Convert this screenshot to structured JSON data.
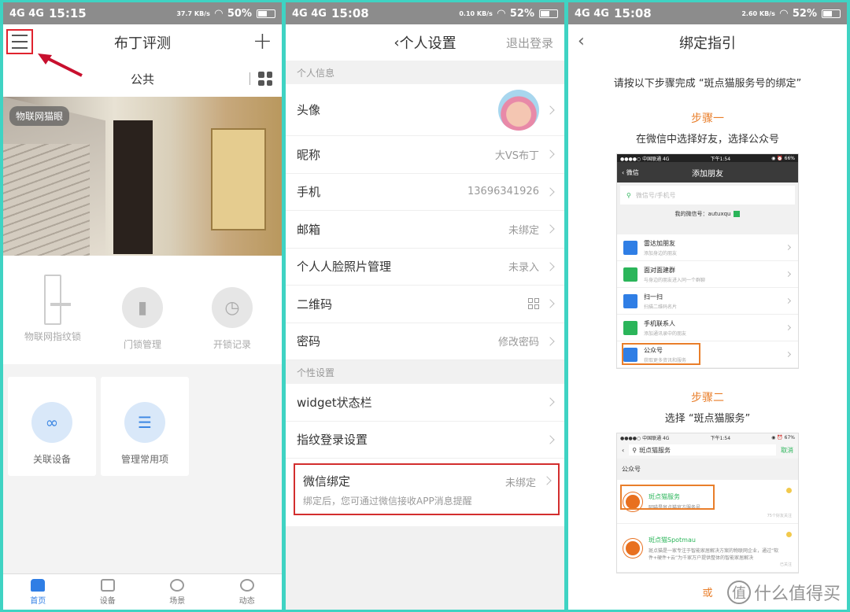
{
  "panel1": {
    "status": {
      "signal": "4G 4G",
      "time": "15:15",
      "speed": "37.7 KB/s",
      "battery": "50%"
    },
    "title": "布丁评测",
    "tab": "公共",
    "camera_tag": "物联网猫眼",
    "devices": [
      {
        "label": "物联网指纹锁",
        "icon": "door-lock-icon"
      },
      {
        "label": "门锁管理",
        "icon": "lock-manage-icon"
      },
      {
        "label": "开锁记录",
        "icon": "clock-icon"
      }
    ],
    "cards": [
      {
        "label": "关联设备",
        "icon": "link-icon"
      },
      {
        "label": "管理常用项",
        "icon": "settings-list-icon"
      }
    ],
    "bottom_nav": [
      {
        "label": "首页",
        "active": true
      },
      {
        "label": "设备"
      },
      {
        "label": "场景"
      },
      {
        "label": "动态"
      }
    ]
  },
  "panel2": {
    "status": {
      "signal": "4G 4G",
      "time": "15:08",
      "speed": "0.10 KB/s",
      "battery": "52%"
    },
    "title": "个人设置",
    "logout": "退出登录",
    "section_personal": "个人信息",
    "rows": [
      {
        "label": "头像",
        "value": ""
      },
      {
        "label": "昵称",
        "value": "大VS布丁"
      },
      {
        "label": "手机",
        "value": "13696341926"
      },
      {
        "label": "邮箱",
        "value": "未绑定"
      },
      {
        "label": "个人人脸照片管理",
        "value": "未录入"
      },
      {
        "label": "二维码",
        "value": ""
      },
      {
        "label": "密码",
        "value": "修改密码"
      }
    ],
    "section_custom": "个性设置",
    "custom_rows": [
      {
        "label": "widget状态栏"
      },
      {
        "label": "指纹登录设置"
      }
    ],
    "wechat": {
      "label": "微信绑定",
      "value": "未绑定",
      "sub": "绑定后，您可通过微信接收APP消息提醒"
    }
  },
  "panel3": {
    "status": {
      "signal": "4G 4G",
      "time": "15:08",
      "speed": "2.60 KB/s",
      "battery": "52%"
    },
    "title": "绑定指引",
    "intro": "请按以下步骤完成 “斑点猫服务号的绑定”",
    "step1_title": "步骤一",
    "step1_desc": "在微信中选择好友，选择公众号",
    "shot1": {
      "status_left": "●●●●○ 中国联通  4G",
      "status_time": "下午1:54",
      "status_right": "◉ ⏰ 66%",
      "back": "微信",
      "title": "添加朋友",
      "search_placeholder": "微信号/手机号",
      "my_id": "我的微信号：autuxqu",
      "items": [
        {
          "title": "雷达加朋友",
          "sub": "添加身边的朋友",
          "color": "#2f7ee5"
        },
        {
          "title": "面对面建群",
          "sub": "与身边的朋友进入同一个群聊",
          "color": "#2bb55a"
        },
        {
          "title": "扫一扫",
          "sub": "扫描二维码名片",
          "color": "#2f7ee5"
        },
        {
          "title": "手机联系人",
          "sub": "添加通讯录中的朋友",
          "color": "#2bb55a"
        },
        {
          "title": "公众号",
          "sub": "获取更多资讯和服务",
          "color": "#2f7ee5"
        }
      ]
    },
    "step2_title": "步骤二",
    "step2_desc": "选择 “斑点猫服务”",
    "shot2": {
      "status_left": "●●●●○ 中国联通  4G",
      "status_time": "下午1:54",
      "status_right": "◉ ⏰ 67%",
      "search_value": "斑点猫服务",
      "cancel": "取消",
      "section": "公众号",
      "accounts": [
        {
          "title": "斑点猫服务",
          "sub": "阿喵是斑点猫官方服务号",
          "meta": "75个好友关注"
        },
        {
          "title": "斑点猫Spotmau",
          "sub": "斑点猫是一家专注于智能家居解决方案的物联网企业，通过“软件+硬件+云”为千家万户提供整体的智能家居解决",
          "meta": "已关注"
        }
      ]
    },
    "or": "或",
    "watermark": "什么值得买",
    "watermark_icon": "值"
  }
}
